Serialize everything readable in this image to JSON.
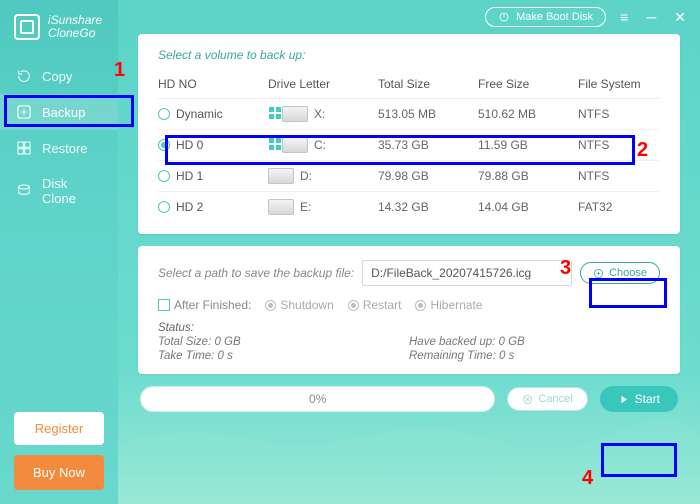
{
  "app_name_line1": "iSunshare",
  "app_name_line2": "CloneGo",
  "titlebar": {
    "make_boot": "Make Boot Disk"
  },
  "sidebar": {
    "items": [
      {
        "label": "Copy"
      },
      {
        "label": "Backup"
      },
      {
        "label": "Restore"
      },
      {
        "label": "Disk Clone"
      }
    ],
    "register": "Register",
    "buy_now": "Buy Now"
  },
  "volumes": {
    "title": "Select a volume to back up:",
    "headers": {
      "hd": "HD NO",
      "letter": "Drive Letter",
      "total": "Total Size",
      "free": "Free Size",
      "fs": "File System"
    },
    "rows": [
      {
        "name": "Dynamic",
        "letter": "X:",
        "total": "513.05 MB",
        "free": "510.62 MB",
        "fs": "NTFS",
        "sys": true,
        "checked": false
      },
      {
        "name": "HD 0",
        "letter": "C:",
        "total": "35.73 GB",
        "free": "11.59 GB",
        "fs": "NTFS",
        "sys": true,
        "checked": true
      },
      {
        "name": "HD 1",
        "letter": "D:",
        "total": "79.98 GB",
        "free": "79.88 GB",
        "fs": "NTFS",
        "sys": false,
        "checked": false
      },
      {
        "name": "HD 2",
        "letter": "E:",
        "total": "14.32 GB",
        "free": "14.04 GB",
        "fs": "FAT32",
        "sys": false,
        "checked": false
      }
    ]
  },
  "path": {
    "label": "Select a path to save the backup file:",
    "value": "D:/FileBack_20207415726.icg",
    "choose": "Choose"
  },
  "after": {
    "label": "After Finished:",
    "shutdown": "Shutdown",
    "restart": "Restart",
    "hibernate": "Hibernate"
  },
  "status": {
    "header": "Status:",
    "total": "Total Size: 0 GB",
    "backed": "Have backed up: 0 GB",
    "take": "Take Time: 0 s",
    "remaining": "Remaining Time: 0 s"
  },
  "bottom": {
    "progress": "0%",
    "cancel": "Cancel",
    "start": "Start"
  },
  "annotations": {
    "n1": "1",
    "n2": "2",
    "n3": "3",
    "n4": "4"
  }
}
